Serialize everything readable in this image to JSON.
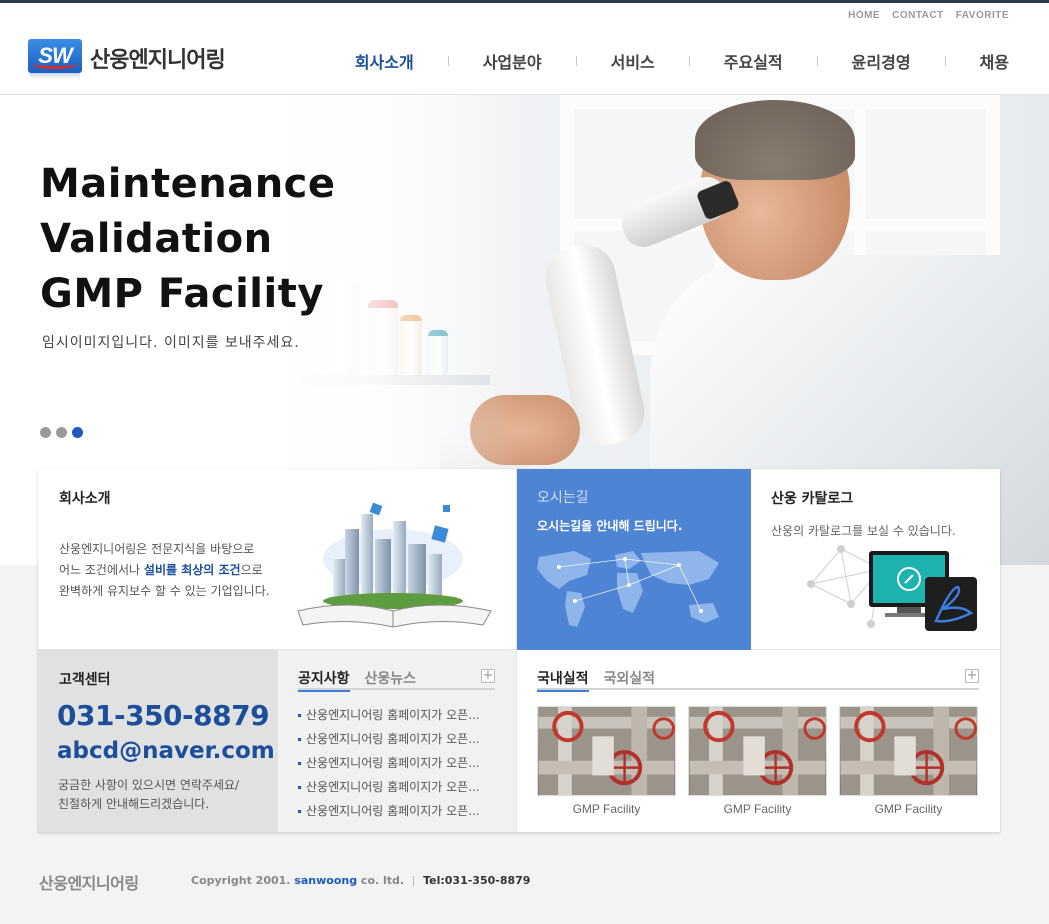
{
  "util_links": [
    "HOME",
    "CONTACT",
    "FAVORITE"
  ],
  "logo": {
    "mark": "SW",
    "name": "산웅엔지니어링"
  },
  "nav": [
    "회사소개",
    "사업분야",
    "서비스",
    "주요실적",
    "윤리경영",
    "채용"
  ],
  "hero": {
    "title_lines": [
      "Maintenance",
      "Validation",
      "GMP Facility"
    ],
    "subtitle": "임시이미지입니다. 이미지를 보내주세요.",
    "slides_total": 3,
    "active_slide": 3
  },
  "about": {
    "title": "회사소개",
    "line1": "산웅엔지니어링은 전문지식을 바탕으로",
    "line2_pre": "어느 조건에서나 ",
    "line2_hl": "설비를 최상의 조건",
    "line2_post": "으로",
    "line3": "완벽하게 유지보수 할  수 있는 기업입니다."
  },
  "directions": {
    "title": "오시는길",
    "desc": "오시는길을 안내해 드립니다."
  },
  "catalog": {
    "title": "산웅 카탈로그",
    "desc": "산웅의 카탈로그를 보실 수 있습니다."
  },
  "customer_center": {
    "title": "고객센터",
    "phone": "031-350-8879",
    "email": "abcd@naver.com",
    "desc_line1": "궁금한 사항이 있으시면 연락주세요/",
    "desc_line2": "친절하게 안내해드리겠습니다."
  },
  "notice": {
    "tabs": [
      "공지사항",
      "산웅뉴스"
    ],
    "items": [
      "산웅엔지니어링 홈페이지가 오픈...",
      "산웅엔지니어링 홈페이지가 오픈...",
      "산웅엔지니어링 홈페이지가 오픈...",
      "산웅엔지니어링 홈페이지가 오픈...",
      "산웅엔지니어링 홈페이지가 오픈..."
    ]
  },
  "works": {
    "tabs": [
      "국내실적",
      "국외실적"
    ],
    "items": [
      "GMP Facility",
      "GMP Facility",
      "GMP Facility"
    ]
  },
  "footer": {
    "name": "산웅엔지니어링",
    "copy_pre": "Copyright 2001. ",
    "brand": "sanwoong",
    "copy_post": " co. ltd.",
    "tel": "Tel:031-350-8879"
  },
  "colors": {
    "accent": "#1b4f9c",
    "map_bg": "#4d84d3",
    "dot_active": "#1b5bbf"
  }
}
